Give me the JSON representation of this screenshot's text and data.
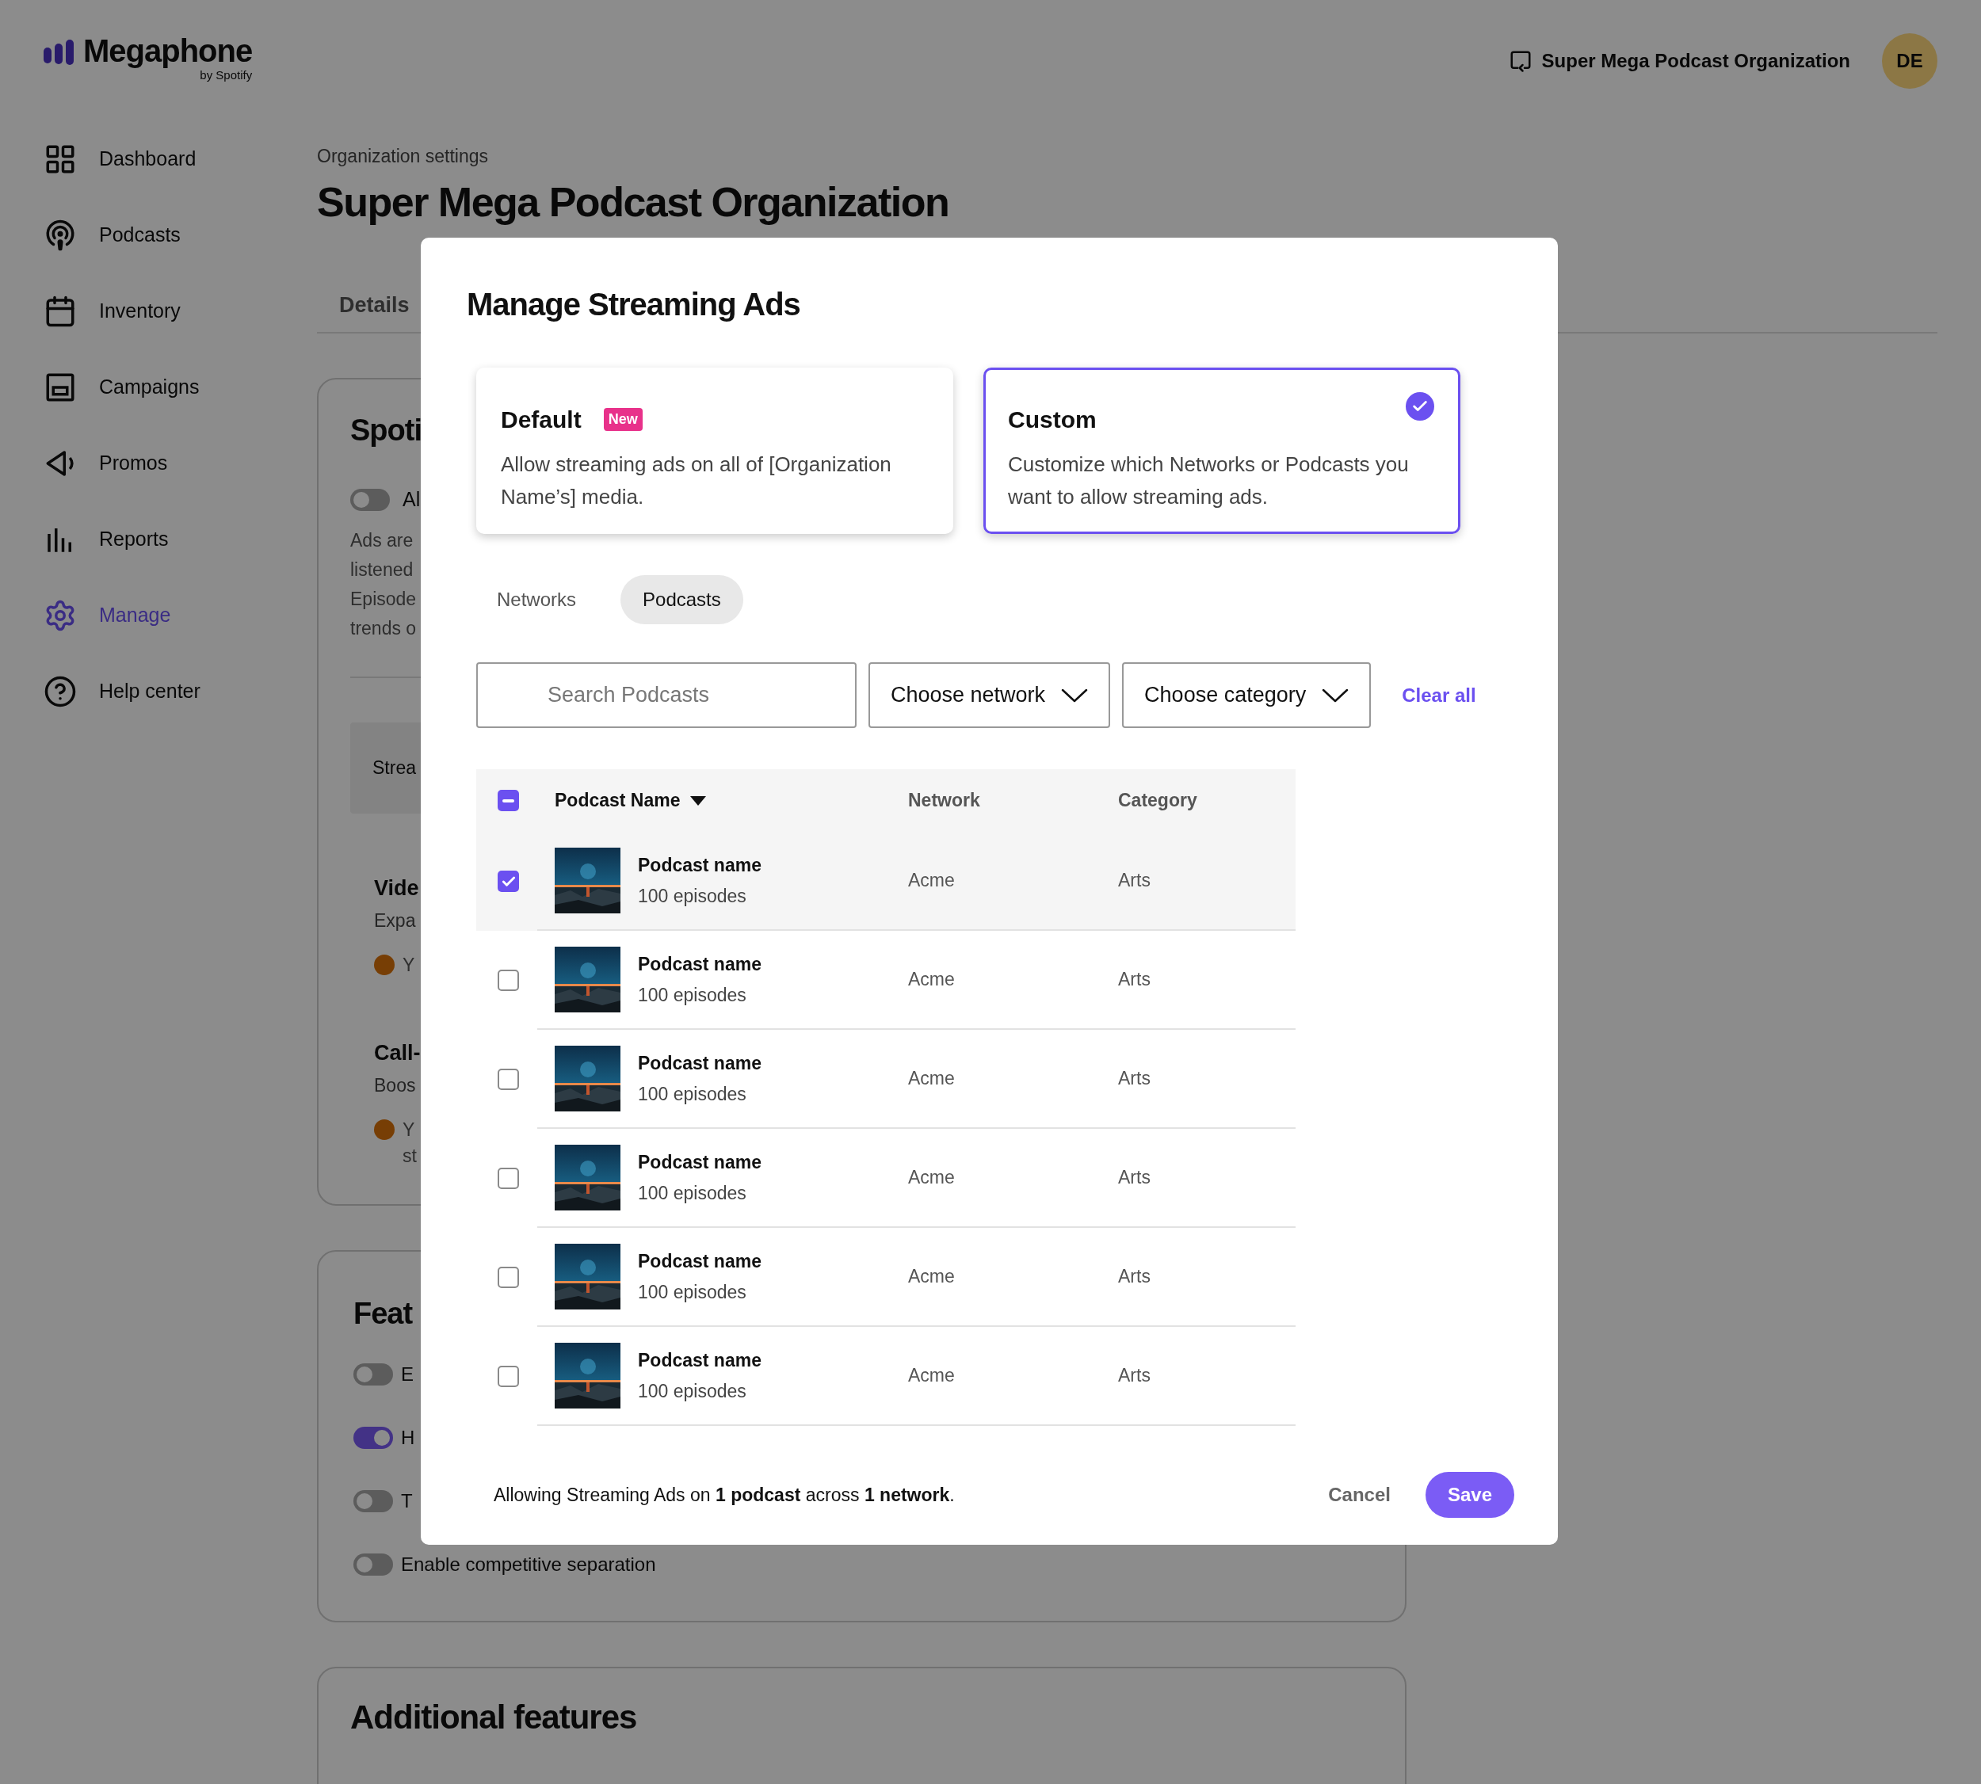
{
  "header": {
    "logo": "Megaphone",
    "logo_sub": "by Spotify",
    "org_switcher": "Super Mega Podcast Organization",
    "avatar": "DE"
  },
  "sidebar": {
    "items": [
      {
        "label": "Dashboard",
        "selected": false
      },
      {
        "label": "Podcasts",
        "selected": false
      },
      {
        "label": "Inventory",
        "selected": false
      },
      {
        "label": "Campaigns",
        "selected": false
      },
      {
        "label": "Promos",
        "selected": false
      },
      {
        "label": "Reports",
        "selected": false
      },
      {
        "label": "Manage",
        "selected": true
      },
      {
        "label": "Help center",
        "selected": false
      }
    ]
  },
  "page": {
    "breadcrumb": "Organization settings",
    "title": "Super Mega Podcast Organization",
    "tabs": [
      {
        "label": "Details"
      }
    ],
    "streaming_card": {
      "title": "Spoti",
      "toggle": {
        "on": false,
        "label": "Al"
      },
      "description_lines": [
        "Ads are",
        "listened",
        "Episode",
        "trends o"
      ],
      "banner": "Strea",
      "sections": [
        {
          "title": "Vide",
          "subtitle": "Expa",
          "warning_lines": [
            "Y"
          ]
        },
        {
          "title": "Call-",
          "subtitle": "Boos",
          "warning_lines": [
            "Y",
            "st"
          ]
        }
      ]
    },
    "features_card": {
      "title": "Feat",
      "toggles": [
        {
          "on": false,
          "label": "E"
        },
        {
          "on": true,
          "label": "H"
        },
        {
          "on": false,
          "label": "T"
        },
        {
          "on": false,
          "label": "Enable competitive separation"
        }
      ]
    },
    "additional_card": {
      "title": "Additional features"
    }
  },
  "modal": {
    "title": "Manage Streaming Ads",
    "options": [
      {
        "title": "Default",
        "badge": "New",
        "description": "Allow streaming ads on all of [Organization Name’s] media.",
        "selected": false
      },
      {
        "title": "Custom",
        "description": "Customize which Networks or Podcasts you want to allow streaming ads.",
        "selected": true
      }
    ],
    "tabs": [
      {
        "label": "Networks",
        "selected": false
      },
      {
        "label": "Podcasts",
        "selected": true
      }
    ],
    "search": {
      "placeholder": "Search Podcasts"
    },
    "dropdowns": [
      {
        "label": "Choose network"
      },
      {
        "label": "Choose category"
      }
    ],
    "clear_all": "Clear all",
    "table": {
      "select_all": {
        "indeterminate": true
      },
      "columns": [
        "Podcast Name",
        "Network",
        "Category"
      ],
      "rows": [
        {
          "name": "Podcast name",
          "episodes": "100 episodes",
          "network": "Acme",
          "category": "Arts",
          "selected": true
        },
        {
          "name": "Podcast name",
          "episodes": "100 episodes",
          "network": "Acme",
          "category": "Arts",
          "selected": false
        },
        {
          "name": "Podcast name",
          "episodes": "100 episodes",
          "network": "Acme",
          "category": "Arts",
          "selected": false
        },
        {
          "name": "Podcast name",
          "episodes": "100 episodes",
          "network": "Acme",
          "category": "Arts",
          "selected": false
        },
        {
          "name": "Podcast name",
          "episodes": "100 episodes",
          "network": "Acme",
          "category": "Arts",
          "selected": false
        },
        {
          "name": "Podcast name",
          "episodes": "100 episodes",
          "network": "Acme",
          "category": "Arts",
          "selected": false
        }
      ]
    },
    "summary": "Allowing Streaming Ads on **1 podcast** across **1 network**.",
    "buttons": [
      {
        "label": "Cancel",
        "kind": "secondary"
      },
      {
        "label": "Save",
        "kind": "primary"
      }
    ]
  }
}
